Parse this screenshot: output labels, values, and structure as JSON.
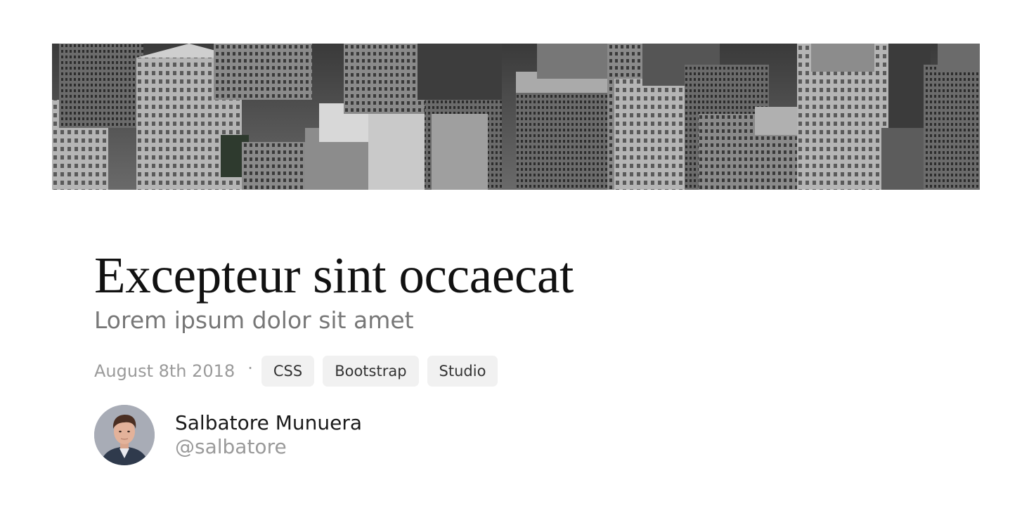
{
  "hero": {
    "image": "aerial-city-photo-grayscale"
  },
  "article": {
    "title": "Excepteur sint occaecat",
    "subtitle": "Lorem ipsum dolor sit amet",
    "date": "August 8th 2018",
    "separator": "·",
    "tags": [
      "CSS",
      "Bootstrap",
      "Studio"
    ]
  },
  "author": {
    "name": "Salbatore Munuera",
    "handle": "@salbatore",
    "avatar": "author-portrait"
  },
  "colors": {
    "title": "#111111",
    "subtitle": "#777777",
    "muted": "#9a9a9a",
    "tag_bg": "#f1f1f1"
  }
}
